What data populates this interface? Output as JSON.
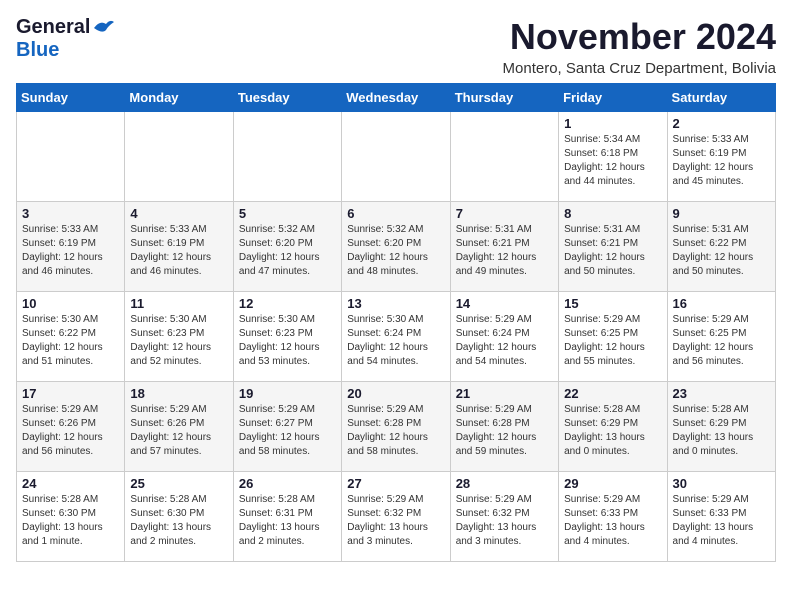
{
  "header": {
    "logo_general": "General",
    "logo_blue": "Blue",
    "month_title": "November 2024",
    "subtitle": "Montero, Santa Cruz Department, Bolivia"
  },
  "weekdays": [
    "Sunday",
    "Monday",
    "Tuesday",
    "Wednesday",
    "Thursday",
    "Friday",
    "Saturday"
  ],
  "weeks": [
    {
      "days": [
        {
          "num": "",
          "info": ""
        },
        {
          "num": "",
          "info": ""
        },
        {
          "num": "",
          "info": ""
        },
        {
          "num": "",
          "info": ""
        },
        {
          "num": "",
          "info": ""
        },
        {
          "num": "1",
          "info": "Sunrise: 5:34 AM\nSunset: 6:18 PM\nDaylight: 12 hours\nand 44 minutes."
        },
        {
          "num": "2",
          "info": "Sunrise: 5:33 AM\nSunset: 6:19 PM\nDaylight: 12 hours\nand 45 minutes."
        }
      ]
    },
    {
      "days": [
        {
          "num": "3",
          "info": "Sunrise: 5:33 AM\nSunset: 6:19 PM\nDaylight: 12 hours\nand 46 minutes."
        },
        {
          "num": "4",
          "info": "Sunrise: 5:33 AM\nSunset: 6:19 PM\nDaylight: 12 hours\nand 46 minutes."
        },
        {
          "num": "5",
          "info": "Sunrise: 5:32 AM\nSunset: 6:20 PM\nDaylight: 12 hours\nand 47 minutes."
        },
        {
          "num": "6",
          "info": "Sunrise: 5:32 AM\nSunset: 6:20 PM\nDaylight: 12 hours\nand 48 minutes."
        },
        {
          "num": "7",
          "info": "Sunrise: 5:31 AM\nSunset: 6:21 PM\nDaylight: 12 hours\nand 49 minutes."
        },
        {
          "num": "8",
          "info": "Sunrise: 5:31 AM\nSunset: 6:21 PM\nDaylight: 12 hours\nand 50 minutes."
        },
        {
          "num": "9",
          "info": "Sunrise: 5:31 AM\nSunset: 6:22 PM\nDaylight: 12 hours\nand 50 minutes."
        }
      ]
    },
    {
      "days": [
        {
          "num": "10",
          "info": "Sunrise: 5:30 AM\nSunset: 6:22 PM\nDaylight: 12 hours\nand 51 minutes."
        },
        {
          "num": "11",
          "info": "Sunrise: 5:30 AM\nSunset: 6:23 PM\nDaylight: 12 hours\nand 52 minutes."
        },
        {
          "num": "12",
          "info": "Sunrise: 5:30 AM\nSunset: 6:23 PM\nDaylight: 12 hours\nand 53 minutes."
        },
        {
          "num": "13",
          "info": "Sunrise: 5:30 AM\nSunset: 6:24 PM\nDaylight: 12 hours\nand 54 minutes."
        },
        {
          "num": "14",
          "info": "Sunrise: 5:29 AM\nSunset: 6:24 PM\nDaylight: 12 hours\nand 54 minutes."
        },
        {
          "num": "15",
          "info": "Sunrise: 5:29 AM\nSunset: 6:25 PM\nDaylight: 12 hours\nand 55 minutes."
        },
        {
          "num": "16",
          "info": "Sunrise: 5:29 AM\nSunset: 6:25 PM\nDaylight: 12 hours\nand 56 minutes."
        }
      ]
    },
    {
      "days": [
        {
          "num": "17",
          "info": "Sunrise: 5:29 AM\nSunset: 6:26 PM\nDaylight: 12 hours\nand 56 minutes."
        },
        {
          "num": "18",
          "info": "Sunrise: 5:29 AM\nSunset: 6:26 PM\nDaylight: 12 hours\nand 57 minutes."
        },
        {
          "num": "19",
          "info": "Sunrise: 5:29 AM\nSunset: 6:27 PM\nDaylight: 12 hours\nand 58 minutes."
        },
        {
          "num": "20",
          "info": "Sunrise: 5:29 AM\nSunset: 6:28 PM\nDaylight: 12 hours\nand 58 minutes."
        },
        {
          "num": "21",
          "info": "Sunrise: 5:29 AM\nSunset: 6:28 PM\nDaylight: 12 hours\nand 59 minutes."
        },
        {
          "num": "22",
          "info": "Sunrise: 5:28 AM\nSunset: 6:29 PM\nDaylight: 13 hours\nand 0 minutes."
        },
        {
          "num": "23",
          "info": "Sunrise: 5:28 AM\nSunset: 6:29 PM\nDaylight: 13 hours\nand 0 minutes."
        }
      ]
    },
    {
      "days": [
        {
          "num": "24",
          "info": "Sunrise: 5:28 AM\nSunset: 6:30 PM\nDaylight: 13 hours\nand 1 minute."
        },
        {
          "num": "25",
          "info": "Sunrise: 5:28 AM\nSunset: 6:30 PM\nDaylight: 13 hours\nand 2 minutes."
        },
        {
          "num": "26",
          "info": "Sunrise: 5:28 AM\nSunset: 6:31 PM\nDaylight: 13 hours\nand 2 minutes."
        },
        {
          "num": "27",
          "info": "Sunrise: 5:29 AM\nSunset: 6:32 PM\nDaylight: 13 hours\nand 3 minutes."
        },
        {
          "num": "28",
          "info": "Sunrise: 5:29 AM\nSunset: 6:32 PM\nDaylight: 13 hours\nand 3 minutes."
        },
        {
          "num": "29",
          "info": "Sunrise: 5:29 AM\nSunset: 6:33 PM\nDaylight: 13 hours\nand 4 minutes."
        },
        {
          "num": "30",
          "info": "Sunrise: 5:29 AM\nSunset: 6:33 PM\nDaylight: 13 hours\nand 4 minutes."
        }
      ]
    }
  ]
}
